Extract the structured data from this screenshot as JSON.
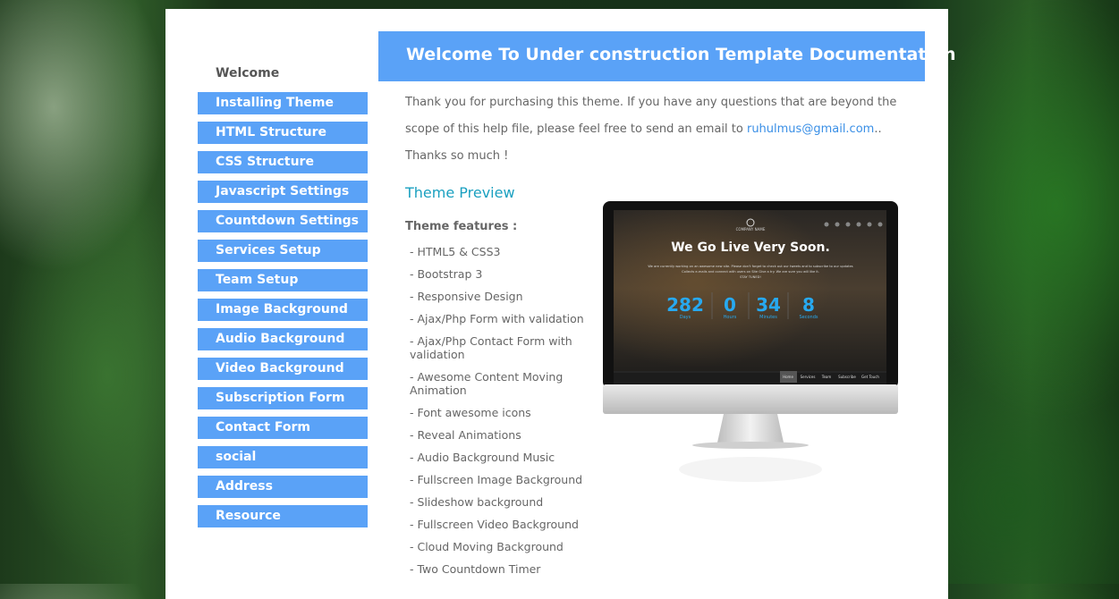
{
  "sidebar": {
    "items": [
      {
        "label": "Welcome"
      },
      {
        "label": "Installing Theme"
      },
      {
        "label": "HTML Structure"
      },
      {
        "label": "CSS Structure"
      },
      {
        "label": "Javascript Settings"
      },
      {
        "label": "Countdown Settings"
      },
      {
        "label": "Services Setup"
      },
      {
        "label": "Team Setup"
      },
      {
        "label": "Image Background"
      },
      {
        "label": "Audio Background"
      },
      {
        "label": "Video Background"
      },
      {
        "label": "Subscription Form"
      },
      {
        "label": "Contact Form"
      },
      {
        "label": "social"
      },
      {
        "label": "Address"
      },
      {
        "label": "Resource"
      }
    ]
  },
  "header": {
    "title": "Welcome To Under construction Template Documentation"
  },
  "intro": {
    "text_before": "Thank you for purchasing this theme. If you have any questions that are beyond the scope of this help file, please feel free to send an email to ",
    "email": "ruhulmus@gmail.com",
    "text_after": ".. Thanks so much !"
  },
  "preview": {
    "title": "Theme Preview",
    "features_title": "Theme features :",
    "features": [
      "- HTML5 & CSS3",
      "- Bootstrap 3",
      "- Responsive Design",
      "- Ajax/Php Form with validation",
      "- Ajax/Php Contact Form with validation",
      "- Awesome Content Moving Animation",
      "- Font awesome icons",
      "- Reveal Animations",
      "- Audio Background Music",
      "- Fullscreen Image Background",
      "- Slideshow background",
      "- Fullscreen Video Background",
      "- Cloud Moving Background",
      "- Two Countdown Timer"
    ]
  },
  "screen": {
    "company": "COMPANY NAME",
    "headline": "We Go Live Very Soon.",
    "blurb_1": "We are currently working on an awesome new site. Please don't forget to check out our tweets and to subscribe to our updates",
    "blurb_2": "Collects e-mails and connect with users on Site Give a try. We are sure you will like it.",
    "blurb_3": "STAY TUNED!",
    "countdown": [
      {
        "value": "282",
        "unit": "Days"
      },
      {
        "value": "0",
        "unit": "Hours"
      },
      {
        "value": "34",
        "unit": "Minutes"
      },
      {
        "value": "8",
        "unit": "Seconds"
      }
    ],
    "nav": [
      "Home",
      "Services",
      "Team",
      "Subscribe",
      "Get Touch"
    ]
  },
  "colors": {
    "accent": "#5aa2f7",
    "heading_teal": "#1aa0c0",
    "link": "#3a8fe6",
    "countdown": "#27a9f0"
  }
}
